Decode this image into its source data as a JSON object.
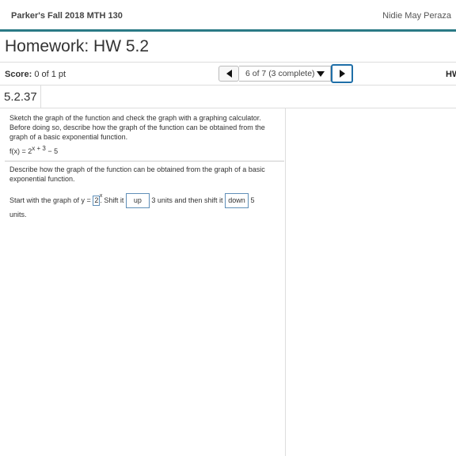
{
  "header": {
    "course": "Parker's Fall 2018 MTH 130",
    "user": "Nidie May Peraza"
  },
  "homework": {
    "title": "Homework: HW 5.2"
  },
  "score": {
    "label": "Score:",
    "value": "0 of 1 pt"
  },
  "nav": {
    "selector_text": "6 of 7 (3 complete)",
    "hw_link": "HW"
  },
  "question": {
    "number": "5.2.37",
    "prompt": "Sketch the graph of the function and check the graph with a graphing calculator. Before doing so, describe how the graph of the function can be obtained from the graph of a basic exponential function.",
    "function_lhs": "f(x) = 2",
    "function_exp": "x + 3",
    "function_rhs": " − 5",
    "describe": "Describe how the graph of the function can be obtained from the graph of a basic exponential function."
  },
  "answer": {
    "start_text": "Start with the graph of y =",
    "base_value": "2",
    "base_exp": "x",
    "shift_text": ". Shift it",
    "shift1_value": "up",
    "mid_text": "3 units and then shift it",
    "shift2_value": "down",
    "end_number": "5",
    "units_text": "units."
  }
}
